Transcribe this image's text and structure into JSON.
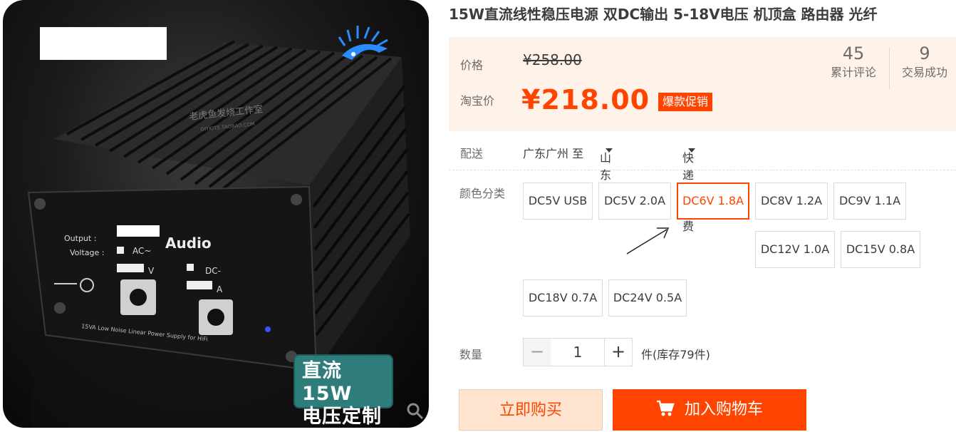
{
  "product": {
    "title": "15W直流线性稳压电源 双DC输出 5-18V电压 机顶盒 路由器 光纤",
    "image": {
      "badge_text": "直流15W\n电压定制",
      "badge_line1": "直流15W",
      "badge_line2": "电压定制",
      "panel_output": "Output :",
      "panel_voltage": "Voltage :",
      "panel_ac": "AC~",
      "panel_dc": "DC-",
      "panel_v": "V",
      "panel_a": "A",
      "panel_audio": "Audio",
      "panel_bottom": "15VA Low Noise Linear Power Supply for HiFi",
      "engraving": "老虎鱼发烧工作室",
      "engraving_sub": "DIYKITS.TAOBAO.COM"
    }
  },
  "price": {
    "label": "价格",
    "original": "¥258.00",
    "sale_label": "淘宝价",
    "currency": "¥",
    "sale_value": "218.00",
    "promo_tag": "爆款促销"
  },
  "stats": {
    "reviews_count": "45",
    "reviews_label": "累计评论",
    "deals_count": "9",
    "deals_label": "交易成功"
  },
  "shipping": {
    "label": "配送",
    "from": "广东广州 至",
    "to": "山东济南",
    "method": "快递 免运费"
  },
  "sku": {
    "label": "颜色分类",
    "options": [
      "DC5V USB",
      "DC5V 2.0A",
      "DC6V 1.8A",
      "DC8V 1.2A",
      "DC9V 1.1A",
      "DC12V 1.0A",
      "DC15V 0.8A",
      "DC18V 0.7A",
      "DC24V 0.5A"
    ],
    "selected": "DC6V 1.8A"
  },
  "quantity": {
    "label": "数量",
    "minus": "−",
    "value": "1",
    "plus": "+",
    "stock_prefix": "件(库存",
    "stock_count": "79",
    "stock_suffix": "件)"
  },
  "actions": {
    "buy_now": "立即购买",
    "add_to_cart": "加入购物车"
  },
  "colors": {
    "accent": "#ff4400",
    "price_bg": "#fff2e8",
    "badge": "#2e7d7a"
  },
  "icons": [
    "zoom-icon",
    "cart-icon",
    "caret-down-icon",
    "brand-logo-icon",
    "screw-icon"
  ]
}
